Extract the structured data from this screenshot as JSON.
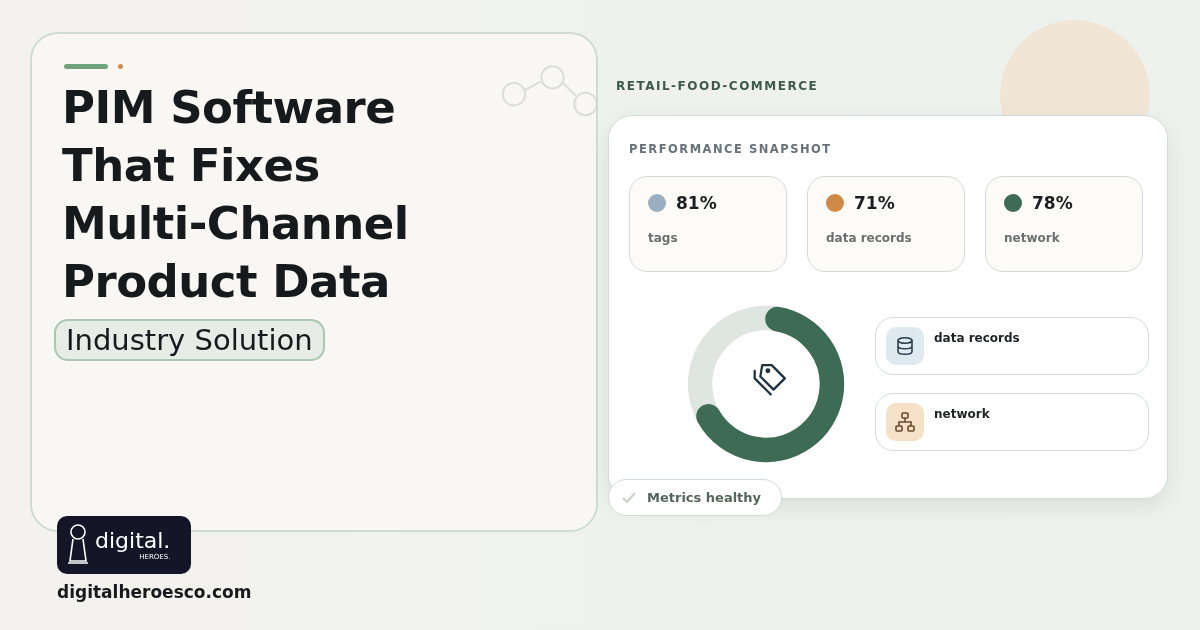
{
  "hero": {
    "title_lines": [
      "PIM Software",
      "That Fixes",
      "Multi-Channel",
      "Product Data"
    ],
    "tag": "Industry Solution"
  },
  "brand": {
    "logo_word": "digital.",
    "logo_sub": "HEROES.",
    "url": "digitalheroesco.com"
  },
  "dashboard": {
    "industry": "RETAIL-FOOD-COMMERCE",
    "heading": "PERFORMANCE SNAPSHOT",
    "stats": [
      {
        "value": "81%",
        "label": "tags",
        "color": "#9aafbf"
      },
      {
        "value": "71%",
        "label": "data records",
        "color": "#cf8a47"
      },
      {
        "value": "78%",
        "label": "network",
        "color": "#3e6b54"
      }
    ],
    "items": [
      {
        "kind": "database",
        "label": "data records"
      },
      {
        "kind": "network",
        "label": "network"
      }
    ],
    "status": "Metrics healthy"
  }
}
